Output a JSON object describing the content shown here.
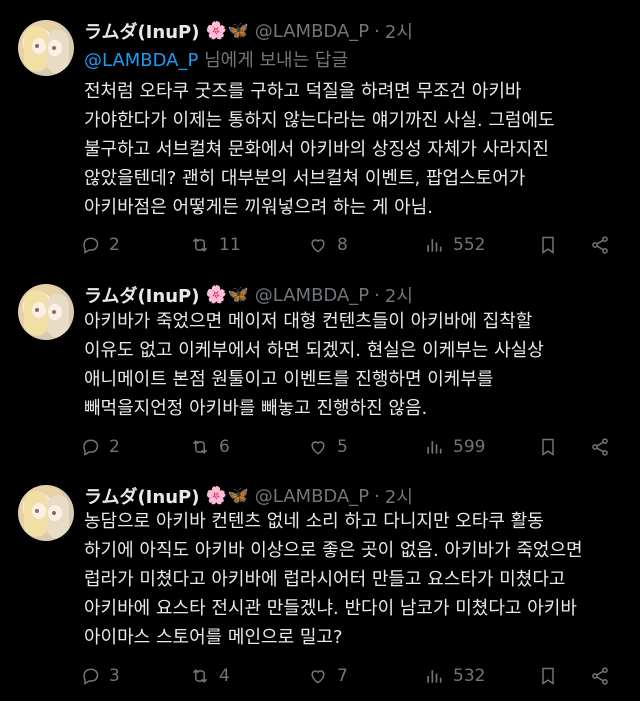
{
  "tweets": [
    {
      "author": "ラムダ(InuP)",
      "emoji_flower": "🌸",
      "emoji_butterfly": "🦋",
      "handle": "@LAMBDA_P",
      "separator": "·",
      "time": "2시",
      "replying_to": "@LAMBDA_P",
      "replying_suffix": " 님에게 보내는 답글",
      "lines": [
        "전처럼 오타쿠 굿즈를 구하고 덕질을 하려면 무조건 아키바",
        "가야한다가 이제는 통하지 않는다라는 얘기까진 사실. 그럼에도",
        "불구하고 서브컬쳐 문화에서 아키바의 상징성 자체가 사라지진",
        "않았을텐데? 괜히 대부분의 서브컬쳐 이벤트, 팝업스토어가",
        "아키바점은 어떻게든 끼워넣으려 하는 게 아님."
      ],
      "replies": "2",
      "retweets": "11",
      "likes": "8",
      "views": "552"
    },
    {
      "author": "ラムダ(InuP)",
      "emoji_flower": "🌸",
      "emoji_butterfly": "🦋",
      "handle": "@LAMBDA_P",
      "separator": "·",
      "time": "2시",
      "lines": [
        "아키바가 죽었으면 메이저 대형 컨텐츠들이 아키바에 집착할",
        "이유도 없고 이케부에서 하면 되겠지. 현실은 이케부는 사실상",
        "애니메이트 본점 원툴이고 이벤트를 진행하면 이케부를",
        "빼먹을지언정 아키바를 빼놓고 진행하진 않음."
      ],
      "replies": "2",
      "retweets": "6",
      "likes": "5",
      "views": "599"
    },
    {
      "author": "ラムダ(InuP)",
      "emoji_flower": "🌸",
      "emoji_butterfly": "🦋",
      "handle": "@LAMBDA_P",
      "separator": "·",
      "time": "2시",
      "lines": [
        "농담으로 아키바 컨텐츠 없네 소리 하고 다니지만 오타쿠 활동",
        "하기에 아직도 아키바 이상으로 좋은 곳이 없음. 아키바가 죽었으면",
        "럽라가 미쳤다고 아키바에 럽라시어터 만들고 요스타가 미쳤다고",
        "아키바에 요스타 전시관 만들겠냐. 반다이 남코가 미쳤다고 아키바",
        "아이마스 스토어를 메인으로 밀고?"
      ],
      "replies": "3",
      "retweets": "4",
      "likes": "7",
      "views": "532"
    }
  ],
  "icons": {
    "reply": "reply-icon",
    "retweet": "retweet-icon",
    "like": "heart-icon",
    "views": "views-icon",
    "bookmark": "bookmark-icon",
    "share": "share-icon"
  },
  "colors": {
    "background": "#000000",
    "text": "#e7e9ea",
    "muted": "#71767b",
    "link": "#1d9bf0"
  }
}
